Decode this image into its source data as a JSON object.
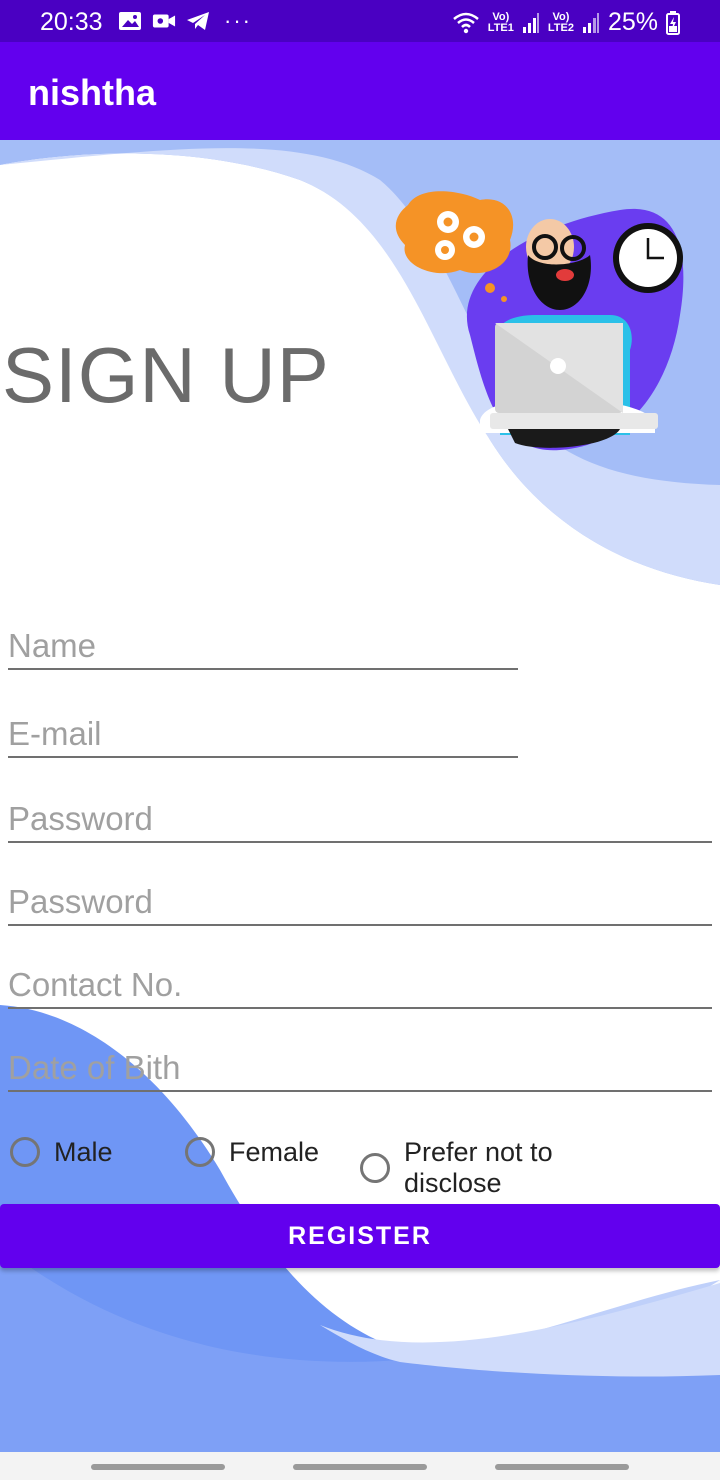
{
  "status_bar": {
    "time": "20:33",
    "more": "···",
    "sim1_label_top": "Vo)",
    "sim1_label_bottom": "LTE1",
    "sim2_label_top": "Vo)",
    "sim2_label_bottom": "LTE2",
    "battery": "25%",
    "icons": [
      "image-icon",
      "video-icon",
      "telegram-icon",
      "wifi-icon",
      "signal-icon",
      "battery-icon"
    ]
  },
  "app_bar": {
    "title": "nishtha"
  },
  "header": {
    "title": "SIGN UP"
  },
  "form": {
    "name_placeholder": "Name",
    "email_placeholder": "E-mail",
    "password_placeholder": "Password",
    "confirm_password_placeholder": "Password",
    "contact_placeholder": "Contact No.",
    "dob_placeholder": "Date of Bith"
  },
  "gender": {
    "options": [
      {
        "label": "Male"
      },
      {
        "label": "Female"
      },
      {
        "label": "Prefer not to disclose"
      }
    ]
  },
  "register_label": "REGISTER",
  "colors": {
    "accent": "#6200ee",
    "status_bar": "#4a00c2",
    "wave_light": "#d0dcfb",
    "wave_mid": "#a4bdf7",
    "wave_dark": "#6f96f5"
  }
}
